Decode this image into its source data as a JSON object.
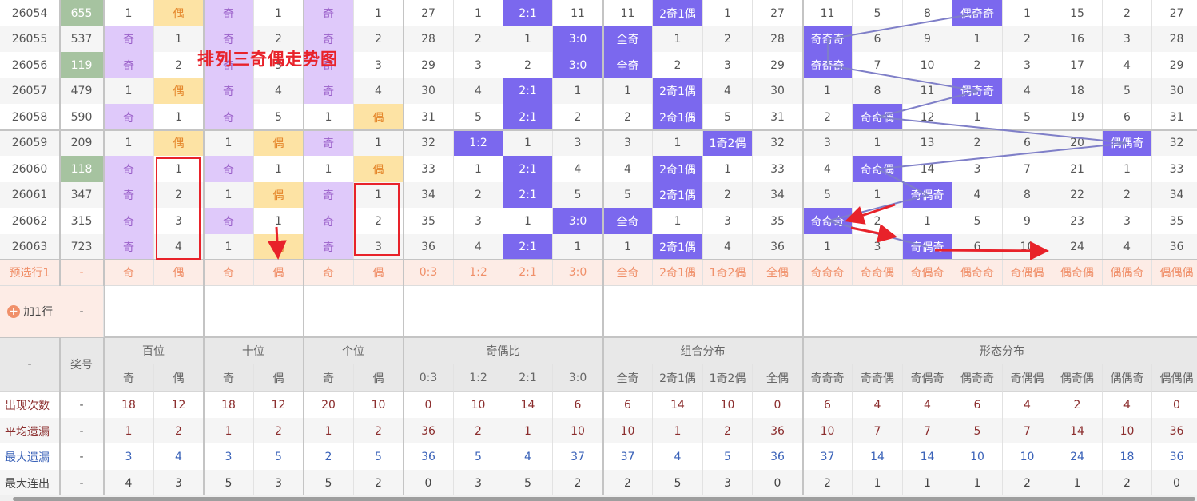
{
  "title_annotation": "排列三奇偶走势图",
  "colors": {
    "odd_bg": "#dfc9fa",
    "even_bg": "#fde3a4",
    "hit_bg": "#7b68ee",
    "highlight_bg": "#a6c3a0",
    "line": "#7f7fc8",
    "annotation": "#e8222a"
  },
  "rows": [
    {
      "issue": "26054",
      "number": "655",
      "highlight": true,
      "cells": [
        "1",
        "偶",
        "奇",
        "1",
        "奇",
        "1",
        "27",
        "1",
        "2:1",
        "11",
        "11",
        "2奇1偶",
        "1",
        "27",
        "11",
        "5",
        "8",
        "偶奇奇",
        "1",
        "15",
        "2",
        "27"
      ]
    },
    {
      "issue": "26055",
      "number": "537",
      "highlight": false,
      "cells": [
        "奇",
        "1",
        "奇",
        "2",
        "奇",
        "2",
        "28",
        "2",
        "1",
        "3:0",
        "全奇",
        "1",
        "2",
        "28",
        "奇奇奇",
        "6",
        "9",
        "1",
        "2",
        "16",
        "3",
        "28"
      ]
    },
    {
      "issue": "26056",
      "number": "119",
      "highlight": true,
      "cells": [
        "奇",
        "2",
        "奇",
        "3",
        "奇",
        "3",
        "29",
        "3",
        "2",
        "3:0",
        "全奇",
        "2",
        "3",
        "29",
        "奇奇奇",
        "7",
        "10",
        "2",
        "3",
        "17",
        "4",
        "29"
      ]
    },
    {
      "issue": "26057",
      "number": "479",
      "highlight": false,
      "cells": [
        "1",
        "偶",
        "奇",
        "4",
        "奇",
        "4",
        "30",
        "4",
        "2:1",
        "1",
        "1",
        "2奇1偶",
        "4",
        "30",
        "1",
        "8",
        "11",
        "偶奇奇",
        "4",
        "18",
        "5",
        "30"
      ]
    },
    {
      "issue": "26058",
      "number": "590",
      "highlight": false,
      "cells": [
        "奇",
        "1",
        "奇",
        "5",
        "1",
        "偶",
        "31",
        "5",
        "2:1",
        "2",
        "2",
        "2奇1偶",
        "5",
        "31",
        "2",
        "奇奇偶",
        "12",
        "1",
        "5",
        "19",
        "6",
        "31"
      ]
    },
    {
      "issue": "26059",
      "number": "209",
      "highlight": false,
      "cells": [
        "1",
        "偶",
        "1",
        "偶",
        "奇",
        "1",
        "32",
        "1:2",
        "1",
        "3",
        "3",
        "1",
        "1奇2偶",
        "32",
        "3",
        "1",
        "13",
        "2",
        "6",
        "20",
        "偶偶奇",
        "32"
      ]
    },
    {
      "issue": "26060",
      "number": "118",
      "highlight": true,
      "cells": [
        "奇",
        "1",
        "奇",
        "1",
        "1",
        "偶",
        "33",
        "1",
        "2:1",
        "4",
        "4",
        "2奇1偶",
        "1",
        "33",
        "4",
        "奇奇偶",
        "14",
        "3",
        "7",
        "21",
        "1",
        "33"
      ]
    },
    {
      "issue": "26061",
      "number": "347",
      "highlight": false,
      "cells": [
        "奇",
        "2",
        "1",
        "偶",
        "奇",
        "1",
        "34",
        "2",
        "2:1",
        "5",
        "5",
        "2奇1偶",
        "2",
        "34",
        "5",
        "1",
        "奇偶奇",
        "4",
        "8",
        "22",
        "2",
        "34"
      ]
    },
    {
      "issue": "26062",
      "number": "315",
      "highlight": false,
      "cells": [
        "奇",
        "3",
        "奇",
        "1",
        "奇",
        "2",
        "35",
        "3",
        "1",
        "3:0",
        "全奇",
        "1",
        "3",
        "35",
        "奇奇奇",
        "2",
        "1",
        "5",
        "9",
        "23",
        "3",
        "35"
      ]
    },
    {
      "issue": "26063",
      "number": "723",
      "highlight": false,
      "cells": [
        "奇",
        "4",
        "1",
        "偶",
        "奇",
        "3",
        "36",
        "4",
        "2:1",
        "1",
        "1",
        "2奇1偶",
        "4",
        "36",
        "1",
        "3",
        "奇偶奇",
        "6",
        "10",
        "24",
        "4",
        "36"
      ]
    }
  ],
  "preselect": {
    "label": "预选行1",
    "number": "-",
    "cells": [
      "奇",
      "偶",
      "奇",
      "偶",
      "奇",
      "偶",
      "0:3",
      "1:2",
      "2:1",
      "3:0",
      "全奇",
      "2奇1偶",
      "1奇2偶",
      "全偶",
      "奇奇奇",
      "奇奇偶",
      "奇偶奇",
      "偶奇奇",
      "奇偶偶",
      "偶奇偶",
      "偶偶奇",
      "偶偶偶"
    ]
  },
  "add_row": {
    "label": "加1行",
    "number": "-"
  },
  "header": {
    "corner": "-",
    "number": "奖号",
    "groups": [
      "百位",
      "十位",
      "个位",
      "奇偶比",
      "组合分布",
      "形态分布"
    ],
    "subs": [
      "奇",
      "偶",
      "奇",
      "偶",
      "奇",
      "偶",
      "0:3",
      "1:2",
      "2:1",
      "3:0",
      "全奇",
      "2奇1偶",
      "1奇2偶",
      "全偶",
      "奇奇奇",
      "奇奇偶",
      "奇偶奇",
      "偶奇奇",
      "奇偶偶",
      "偶奇偶",
      "偶偶奇",
      "偶偶偶"
    ]
  },
  "stats": [
    {
      "label": "出现次数",
      "number": "-",
      "color": "#8b2d2d",
      "values": [
        "18",
        "12",
        "18",
        "12",
        "20",
        "10",
        "0",
        "10",
        "14",
        "6",
        "6",
        "14",
        "10",
        "0",
        "6",
        "4",
        "4",
        "6",
        "4",
        "2",
        "4",
        "0"
      ]
    },
    {
      "label": "平均遗漏",
      "number": "-",
      "color": "#8b2d2d",
      "values": [
        "1",
        "2",
        "1",
        "2",
        "1",
        "2",
        "36",
        "2",
        "1",
        "10",
        "10",
        "1",
        "2",
        "36",
        "10",
        "7",
        "7",
        "5",
        "7",
        "14",
        "10",
        "36"
      ]
    },
    {
      "label": "最大遗漏",
      "number": "-",
      "color": "#3a62b8",
      "values": [
        "3",
        "4",
        "3",
        "5",
        "2",
        "5",
        "36",
        "5",
        "4",
        "37",
        "37",
        "4",
        "5",
        "36",
        "37",
        "14",
        "14",
        "10",
        "10",
        "24",
        "18",
        "36"
      ]
    },
    {
      "label": "最大连出",
      "number": "-",
      "color": "#444444",
      "values": [
        "4",
        "3",
        "5",
        "3",
        "5",
        "2",
        "0",
        "3",
        "5",
        "2",
        "2",
        "5",
        "3",
        "0",
        "2",
        "1",
        "1",
        "1",
        "2",
        "1",
        "2",
        "0"
      ]
    }
  ]
}
